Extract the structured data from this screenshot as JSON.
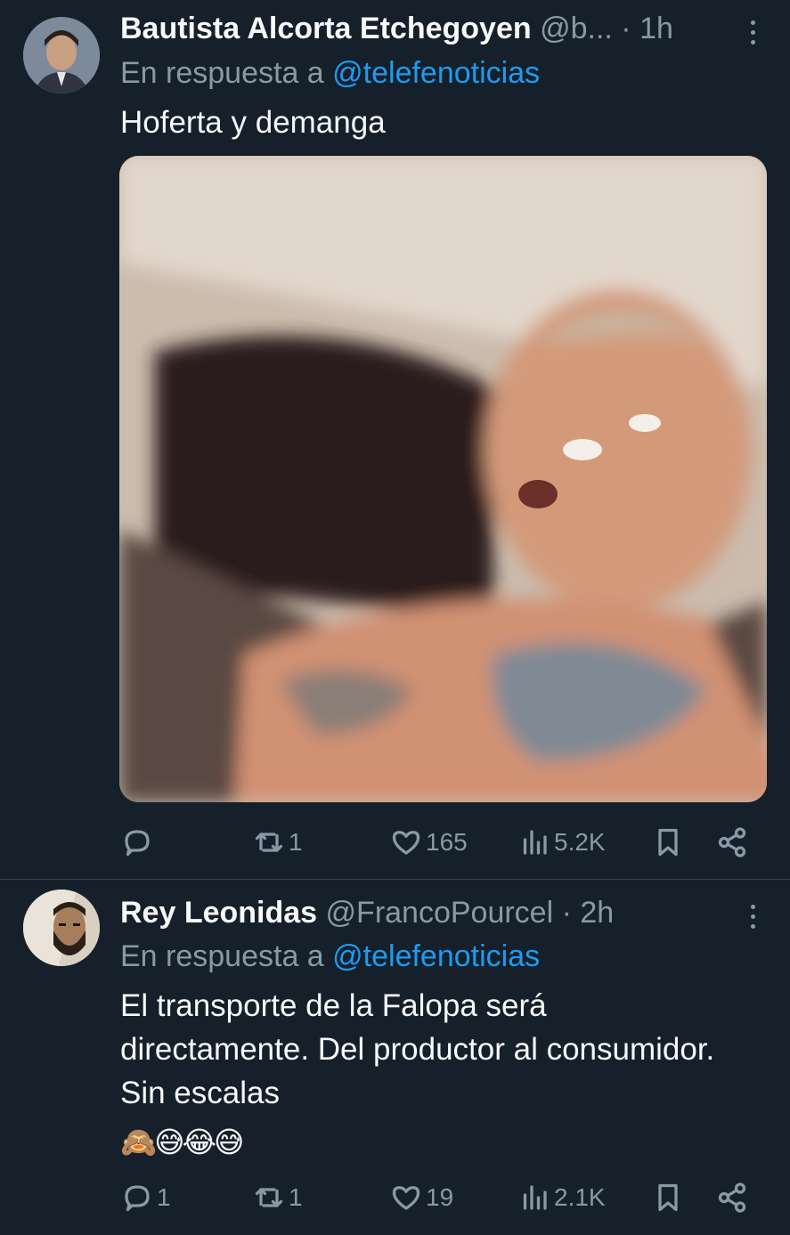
{
  "tweets": [
    {
      "author_name": "Bautista Alcorta Etchegoyen",
      "handle": "@b...",
      "time": "1h",
      "reply_prefix": "En respuesta a",
      "reply_to": "@telefenoticias",
      "text": "Hoferta y demanga",
      "stats": {
        "replies": "",
        "retweets": "1",
        "likes": "165",
        "views": "5.2K"
      }
    },
    {
      "author_name": "Rey Leonidas",
      "handle": "@FrancoPourcel",
      "time": "2h",
      "reply_prefix": "En respuesta a",
      "reply_to": "@telefenoticias",
      "text": "El transporte de la Falopa será directamente. Del productor al consumidor. Sin escalas",
      "emojis": "🙈😅😂😅",
      "stats": {
        "replies": "1",
        "retweets": "1",
        "likes": "19",
        "views": "2.1K"
      }
    }
  ],
  "separator": " · ",
  "colors": {
    "background": "#15202b",
    "text": "#f7f9f9",
    "muted": "#8b98a5",
    "accent": "#1d9bf0",
    "divider": "#38444d"
  },
  "icons": [
    "reply-icon",
    "retweet-icon",
    "like-icon",
    "views-icon",
    "bookmark-icon",
    "share-icon",
    "more-icon"
  ]
}
